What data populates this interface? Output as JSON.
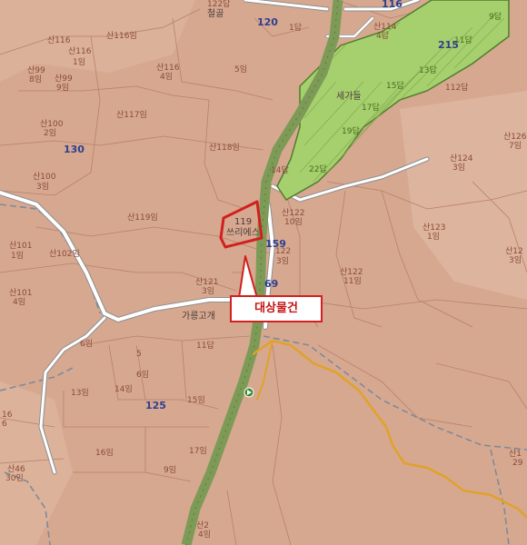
{
  "callout": {
    "text": "대상물건"
  },
  "subject_parcel": {
    "label": "쓰리에스",
    "number": "119"
  },
  "colors": {
    "background": "#d6a890",
    "road_green": "#7d9b57",
    "highlight_red": "#d21f1f",
    "orange_path": "#e0a22a",
    "forest_green": "#a6cf6e"
  },
  "labels": {
    "l01": "122답",
    "l02": "철골",
    "l03": "120",
    "l04": "1답",
    "l05": "116",
    "l06": "산114",
    "l07": "4답",
    "l08": "산116임",
    "l09": "산116",
    "l10": "산116",
    "l11": "1임",
    "l12": "산99",
    "l13": "8임",
    "l14": "산99",
    "l15": "9임",
    "l16": "산116",
    "l17": "4임",
    "l18": "5임",
    "l19": "215",
    "l20": "9답",
    "l21": "11답",
    "l22": "13답",
    "l23": "15답",
    "l24": "112답",
    "l25": "산117임",
    "l26": "산100",
    "l27": "2임",
    "l28": "130",
    "l29": "산118임",
    "l30": "산100",
    "l31": "3임",
    "l32": "산119임",
    "l33": "산101",
    "l34": "1임",
    "l35": "산102임",
    "l36": "산101",
    "l37": "4임",
    "l38": "산121",
    "l39": "3임",
    "l40": "가릉고개",
    "l41": "6임",
    "l42": "11답",
    "l43": "5",
    "l44": "6임",
    "l45": "13임",
    "l46": "14임",
    "l47": "125",
    "l48": "15임",
    "l49": "16",
    "l50": "6",
    "l51": "16임",
    "l52": "17임",
    "l53": "9임",
    "l54": "산46",
    "l55": "30임",
    "l56": "산2",
    "l57": "4임",
    "l58": "산122",
    "l59": "10임",
    "l60": "산122",
    "l61": "11임",
    "l62": "산123",
    "l63": "1임",
    "l64": "산124",
    "l65": "3임",
    "l66": "산126",
    "l67": "7임",
    "l68": "산12",
    "l69": "3임",
    "l70": "산1",
    "l71": "29",
    "l72": "세가들",
    "l73": "17답",
    "l74": "19답",
    "l75": "22답",
    "l76": "14답",
    "l77": "122",
    "l78": "3임",
    "l79": "159",
    "l80": "69"
  }
}
